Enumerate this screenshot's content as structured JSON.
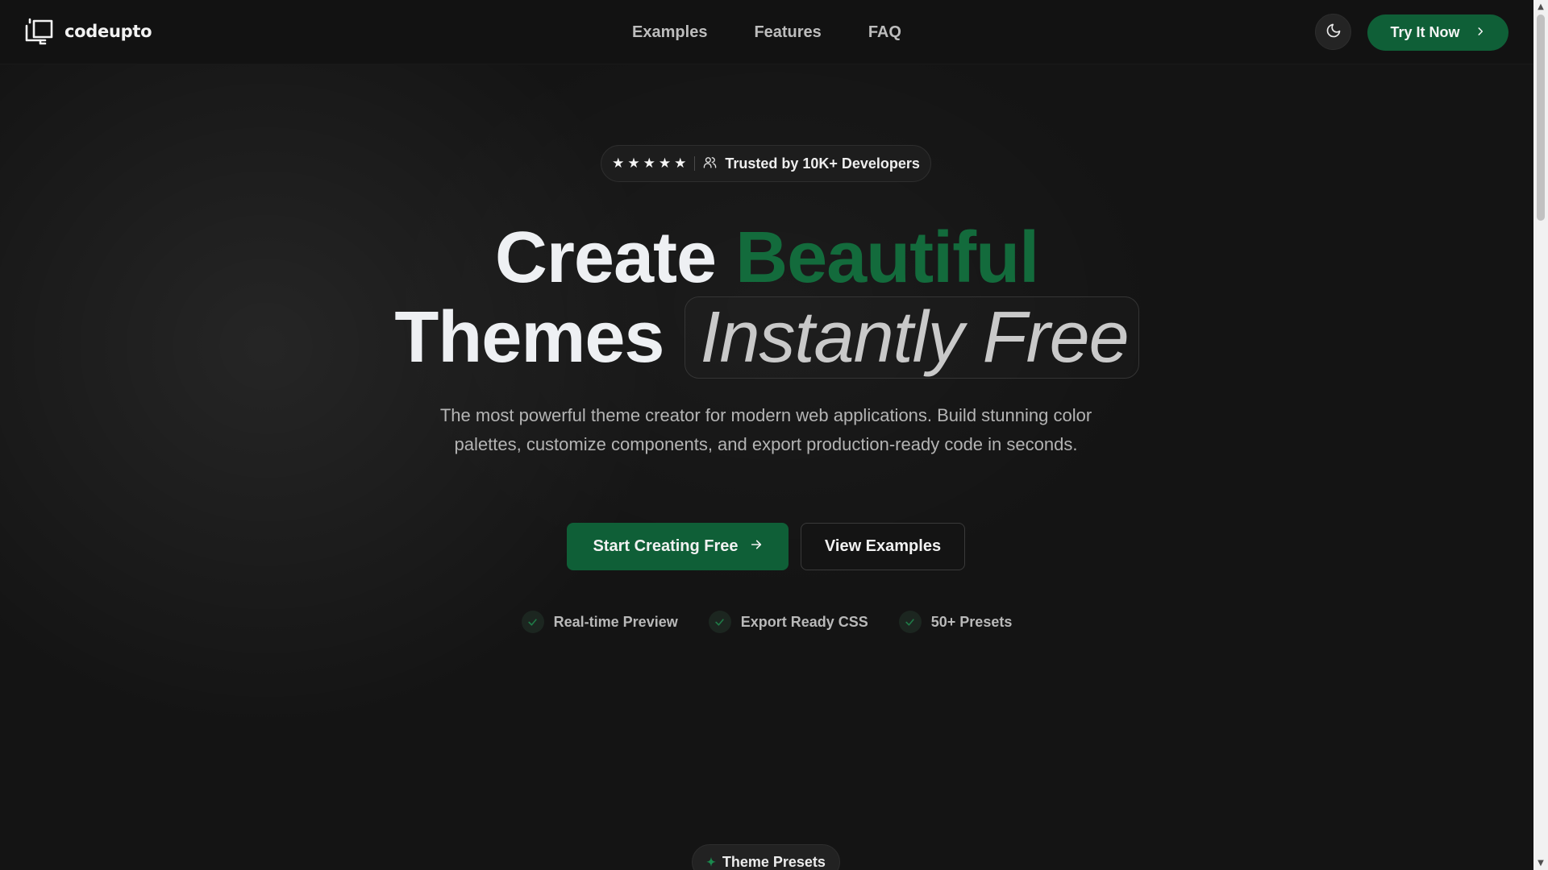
{
  "header": {
    "brand": "codeupto",
    "nav": [
      "Examples",
      "Features",
      "FAQ"
    ],
    "cta_label": "Try It Now",
    "icons": {
      "logo": "codeupto-logo-icon",
      "theme_toggle": "moon-icon",
      "cta": "chevron-right-icon"
    }
  },
  "hero": {
    "badge": {
      "rating_stars": 5,
      "icon": "users-icon",
      "text": "Trusted by 10K+ Developers"
    },
    "title": {
      "line1_word1": "Create",
      "line1_word2": "Beautiful",
      "line2_word1": "Themes",
      "line2_word2": "Instantly Free"
    },
    "description": "The most powerful theme creator for modern web applications. Build stunning color palettes, customize components, and export production-ready code in seconds.",
    "primary_cta": "Start Creating Free",
    "secondary_cta": "View Examples",
    "features": [
      "Real-time Preview",
      "Export Ready CSS",
      "50+ Presets"
    ]
  },
  "next_section": {
    "pill_label": "Theme Presets"
  },
  "colors": {
    "background": "#141414",
    "accent": "#0f5f37",
    "accent_text": "#136b3c",
    "text_primary": "#eef0f3",
    "text_muted": "#b4b4b4"
  }
}
